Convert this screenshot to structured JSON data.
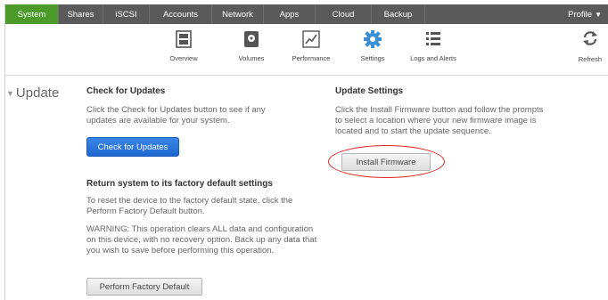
{
  "nav": {
    "tabs": [
      "System",
      "Shares",
      "iSCSI",
      "Accounts",
      "Network",
      "Apps",
      "Cloud",
      "Backup"
    ],
    "active": "System",
    "profile": "Profile"
  },
  "subnav": {
    "items": [
      "Overview",
      "Volumes",
      "Performance",
      "Settings",
      "Logs and Alerts"
    ],
    "active": "Settings",
    "refresh": "Refresh"
  },
  "section": {
    "title": "Update"
  },
  "check": {
    "title": "Check for Updates",
    "text1": "Click the Check for Updates button to see if any",
    "text2": "updates are available for your system.",
    "button": "Check for Updates"
  },
  "factory": {
    "title": "Return system to its factory default settings",
    "text1": "To reset the device to the factory default state, click the",
    "text2": "Perform Factory Default button.",
    "warn1": "WARNING: This operation clears ALL data and configuration",
    "warn2": "on this device, with no recovery option. Back up any data that",
    "warn3": "you wish to save before performing this operation.",
    "button": "Perform Factory Default"
  },
  "update_settings": {
    "title": "Update Settings",
    "text1": "Click the Install Firmware button and follow the prompts",
    "text2": "to select a location where your new firmware image is",
    "text3": "located and to start the update sequence.",
    "button": "Install Firmware"
  },
  "colors": {
    "active_tab": "#4c9a2a",
    "nav_bg": "#5a5a5a",
    "primary_button": "#2a74dc",
    "highlight": "#e0231b",
    "settings_icon": "#3a8fd6"
  }
}
